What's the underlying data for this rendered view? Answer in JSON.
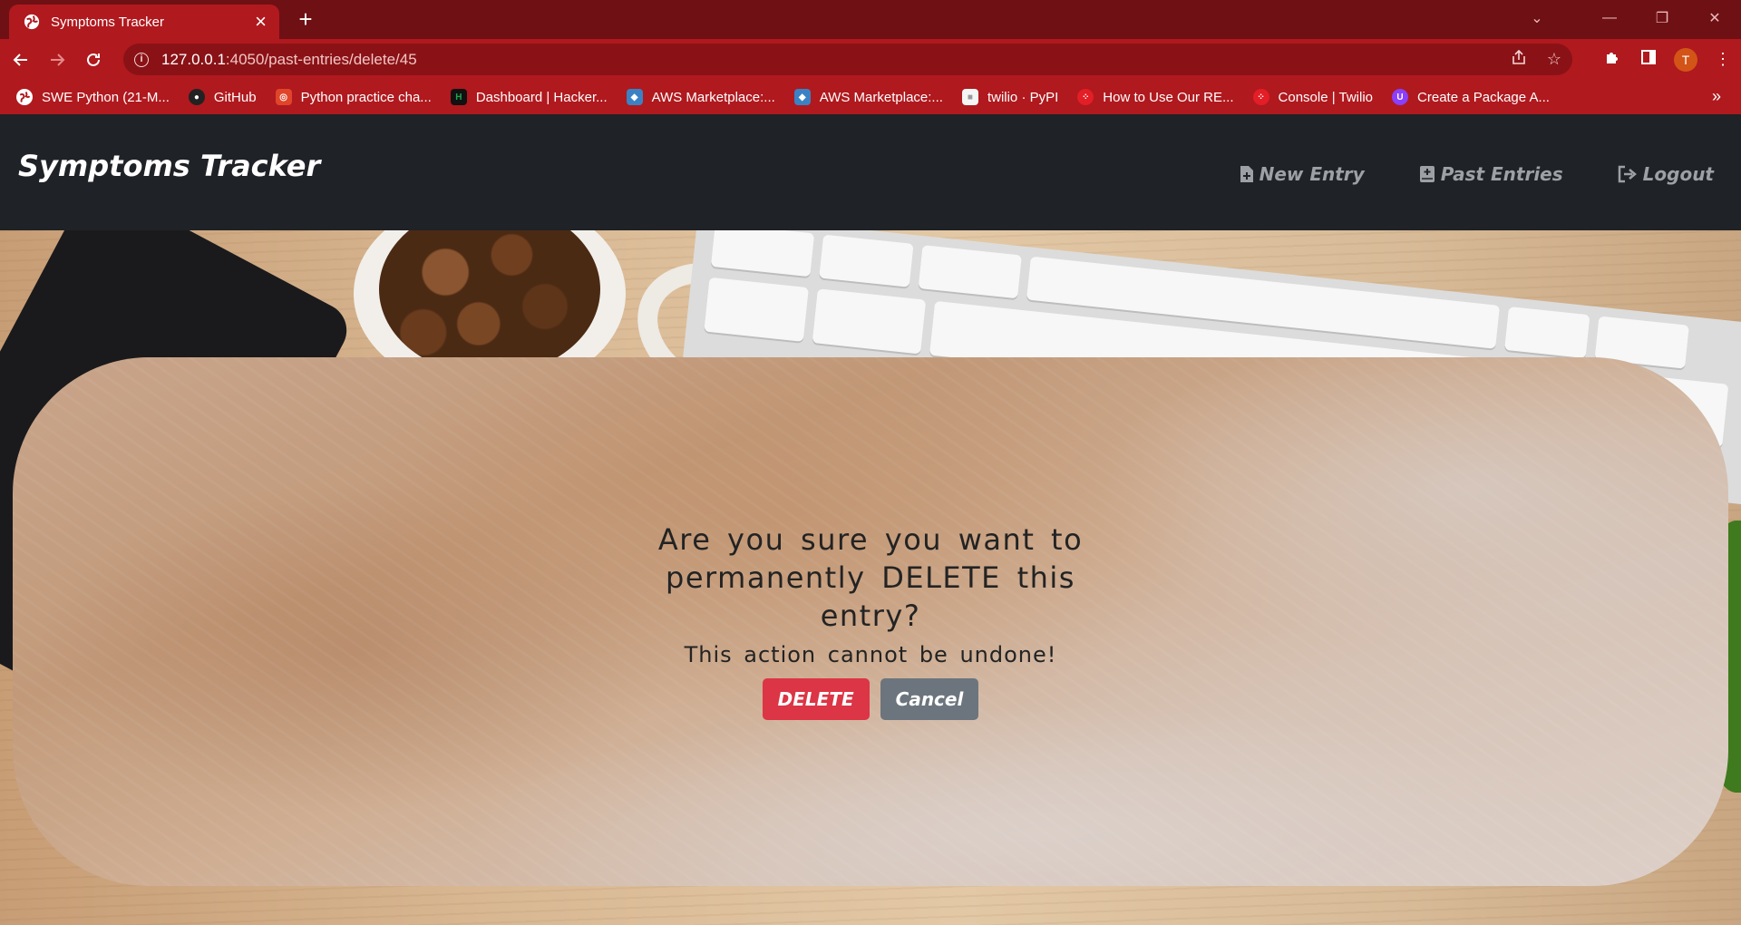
{
  "browser": {
    "tab_title": "Symptoms Tracker",
    "new_tab_label": "+",
    "url_host": "127.0.0.1",
    "url_path": ":4050/past-entries/delete/45",
    "profile_initial": "T",
    "bookmarks": [
      {
        "label": "SWE Python (21-M...",
        "icon": "globe-icon",
        "color": "#ffffff"
      },
      {
        "label": "GitHub",
        "icon": "github-icon",
        "color": "#222222"
      },
      {
        "label": "Python practice cha...",
        "icon": "practice-icon",
        "color": "#e0452a"
      },
      {
        "label": "Dashboard | Hacker...",
        "icon": "hackerrank-icon",
        "color": "#111111"
      },
      {
        "label": "AWS Marketplace:...",
        "icon": "aws-icon",
        "color": "#3b82c4"
      },
      {
        "label": "AWS Marketplace:...",
        "icon": "aws-icon",
        "color": "#3b82c4"
      },
      {
        "label": "twilio · PyPI",
        "icon": "pypi-icon",
        "color": "#f5f5f5"
      },
      {
        "label": "How to Use Our RE...",
        "icon": "twilio-icon",
        "color": "#e31e26"
      },
      {
        "label": "Console | Twilio",
        "icon": "twilio-icon",
        "color": "#e31e26"
      },
      {
        "label": "Create a Package A...",
        "icon": "package-icon",
        "color": "#8a3ffc"
      }
    ]
  },
  "navbar": {
    "brand": "Symptoms Tracker",
    "links": [
      {
        "label": "New Entry",
        "icon": "file-plus-icon"
      },
      {
        "label": "Past Entries",
        "icon": "book-icon"
      },
      {
        "label": "Logout",
        "icon": "logout-icon"
      }
    ]
  },
  "dialog": {
    "question": "Are you sure you want to permanently DELETE this entry?",
    "warning": "This action cannot be undone!",
    "delete_label": "DELETE",
    "cancel_label": "Cancel"
  },
  "colors": {
    "chrome_accent": "#b0191e",
    "navbar_bg": "#1f2226",
    "danger": "#dc3545",
    "secondary": "#6c757d"
  }
}
